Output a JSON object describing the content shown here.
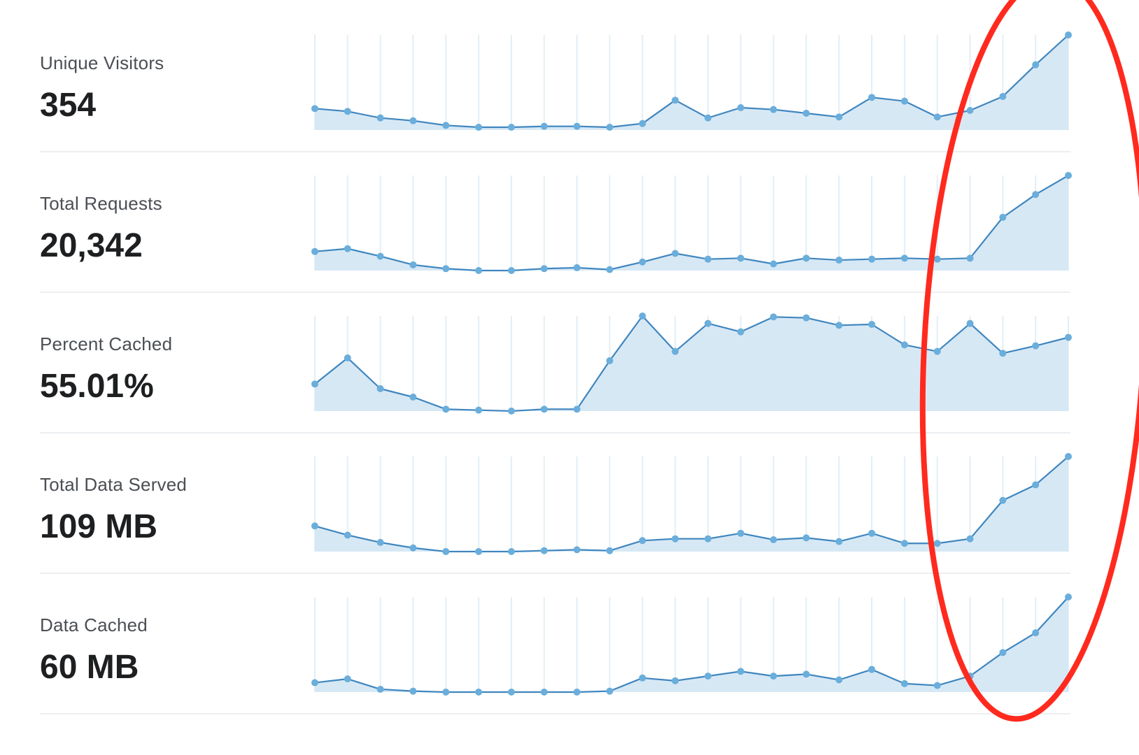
{
  "colors": {
    "line": "#3f86bf",
    "fill": "#d7e8f5",
    "point": "#6aaedb",
    "grid": "#e3eef6",
    "annotation": "#ff2a1e"
  },
  "chart_data": [
    {
      "type": "area",
      "label": "Unique Visitors",
      "value": "354",
      "x": [
        1,
        2,
        3,
        4,
        5,
        6,
        7,
        8,
        9,
        10,
        11,
        12,
        13,
        14,
        15,
        16,
        17,
        18,
        19,
        20,
        21,
        22,
        23,
        24
      ],
      "values": [
        23,
        20,
        13,
        10,
        5,
        3,
        3,
        4,
        4,
        3,
        7,
        32,
        13,
        24,
        22,
        18,
        14,
        35,
        31,
        14,
        21,
        36,
        70,
        102
      ],
      "ylim": [
        0,
        102
      ]
    },
    {
      "type": "area",
      "label": "Total Requests",
      "value": "20,342",
      "x": [
        1,
        2,
        3,
        4,
        5,
        6,
        7,
        8,
        9,
        10,
        11,
        12,
        13,
        14,
        15,
        16,
        17,
        18,
        19,
        20,
        21,
        22,
        23,
        24
      ],
      "values": [
        20,
        23,
        15,
        6,
        2,
        0,
        0,
        2,
        3,
        1,
        9,
        18,
        12,
        13,
        7,
        13,
        11,
        12,
        13,
        12,
        13,
        56,
        80,
        100
      ],
      "ylim": [
        0,
        100
      ]
    },
    {
      "type": "area",
      "label": "Percent Cached",
      "value": "55.01%",
      "x": [
        1,
        2,
        3,
        4,
        5,
        6,
        7,
        8,
        9,
        10,
        11,
        12,
        13,
        14,
        15,
        16,
        17,
        18,
        19,
        20,
        21,
        22,
        23,
        24
      ],
      "values": [
        27,
        55,
        22,
        13,
        0,
        -1,
        -2,
        0,
        0,
        52,
        100,
        62,
        92,
        83,
        99,
        98,
        90,
        91,
        69,
        62,
        92,
        60,
        68,
        77
      ],
      "ylim": [
        -2,
        100
      ]
    },
    {
      "type": "area",
      "label": "Total Data Served",
      "value": "109 MB",
      "x": [
        1,
        2,
        3,
        4,
        5,
        6,
        7,
        8,
        9,
        10,
        11,
        12,
        13,
        14,
        15,
        16,
        17,
        18,
        19,
        20,
        21,
        22,
        23,
        24
      ],
      "values": [
        28,
        18,
        10,
        4,
        0,
        0,
        0,
        1,
        2,
        1,
        12,
        14,
        14,
        20,
        13,
        15,
        11,
        20,
        9,
        9,
        14,
        56,
        73,
        104
      ],
      "ylim": [
        0,
        104
      ]
    },
    {
      "type": "area",
      "label": "Data Cached",
      "value": "60 MB",
      "x": [
        1,
        2,
        3,
        4,
        5,
        6,
        7,
        8,
        9,
        10,
        11,
        12,
        13,
        14,
        15,
        16,
        17,
        18,
        19,
        20,
        21,
        22,
        23,
        24
      ],
      "values": [
        10,
        14,
        3,
        1,
        0,
        0,
        0,
        0,
        0,
        1,
        15,
        12,
        17,
        22,
        17,
        19,
        13,
        24,
        9,
        7,
        17,
        42,
        63,
        101
      ],
      "ylim": [
        0,
        101
      ]
    }
  ]
}
